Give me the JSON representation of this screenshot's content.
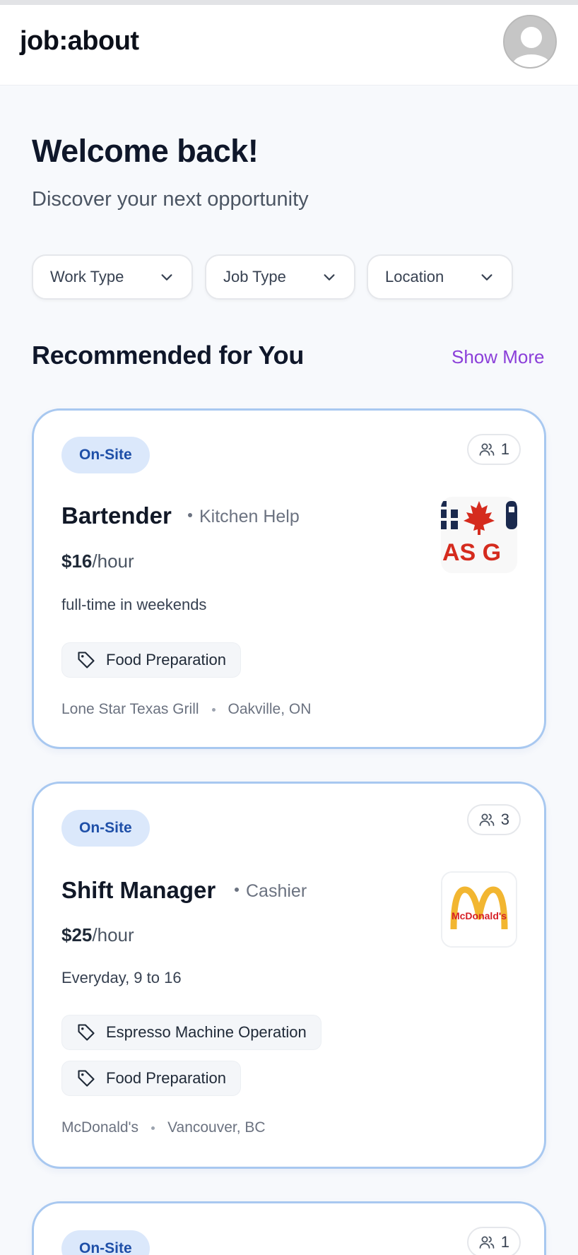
{
  "app": {
    "title": "job:about"
  },
  "header": {
    "avatar": "user-avatar"
  },
  "hero": {
    "welcome": "Welcome back!",
    "subtitle": "Discover your next opportunity"
  },
  "filters": [
    {
      "label": "Work Type"
    },
    {
      "label": "Job Type"
    },
    {
      "label": "Location"
    }
  ],
  "recommended": {
    "title": "Recommended for You",
    "show_more": "Show More"
  },
  "jobs": [
    {
      "work_mode": "On-Site",
      "applicants": "1",
      "title": "Bartender",
      "category": "Kitchen Help",
      "pay_amount": "$16",
      "pay_unit": "/hour",
      "schedule": "full-time in weekends",
      "skills": [
        "Food Preparation"
      ],
      "company": "Lone Star Texas Grill",
      "location": "Oakville, ON",
      "logo_text": "AS G"
    },
    {
      "work_mode": "On-Site",
      "applicants": "3",
      "title": "Shift Manager",
      "category": "Cashier",
      "pay_amount": "$25",
      "pay_unit": "/hour",
      "schedule": "Everyday, 9 to 16",
      "skills": [
        "Espresso Machine Operation",
        "Food Preparation"
      ],
      "company": "McDonald's",
      "location": "Vancouver, BC",
      "logo_text": "McDonald's"
    },
    {
      "work_mode": "On-Site",
      "applicants": "1"
    }
  ],
  "colors": {
    "accent": "#8b3fd9",
    "badge_bg": "#dbe8fb",
    "badge_text": "#1e4fa8",
    "card_border": "#a8c8f0"
  }
}
